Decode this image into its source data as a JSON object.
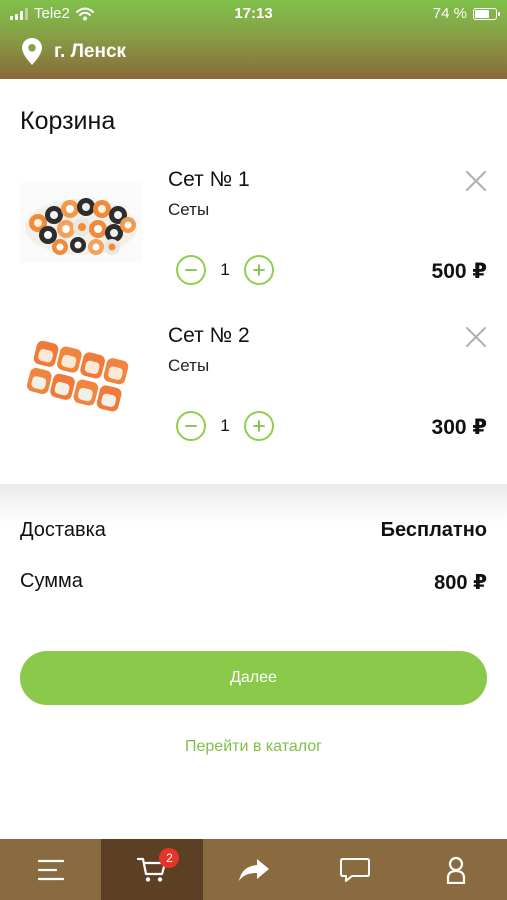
{
  "status_bar": {
    "carrier": "Tele2",
    "time": "17:13",
    "battery": "74 %",
    "battery_level": 0.74
  },
  "header": {
    "city": "г. Ленск",
    "icon": "location-pin-icon"
  },
  "cart": {
    "title": "Корзина",
    "items": [
      {
        "name": "Сет № 1",
        "category": "Сеты",
        "quantity": "1",
        "price": "500 ₽"
      },
      {
        "name": "Сет № 2",
        "category": "Сеты",
        "quantity": "1",
        "price": "300 ₽"
      }
    ]
  },
  "summary": {
    "delivery_label": "Доставка",
    "delivery_value": "Бесплатно",
    "total_label": "Сумма",
    "total_value": "800 ₽"
  },
  "actions": {
    "next_label": "Далее",
    "catalog_link": "Перейти в каталог"
  },
  "tabbar": {
    "cart_badge": "2",
    "tabs": [
      "menu-icon",
      "cart-icon",
      "share-icon",
      "chat-icon",
      "profile-icon"
    ],
    "active_tab": "cart-icon"
  },
  "colors": {
    "accent_green": "#8bc94a",
    "tabbar_brown": "#8a6b40",
    "tabbar_active": "#5d4024",
    "badge_red": "#e53527"
  }
}
